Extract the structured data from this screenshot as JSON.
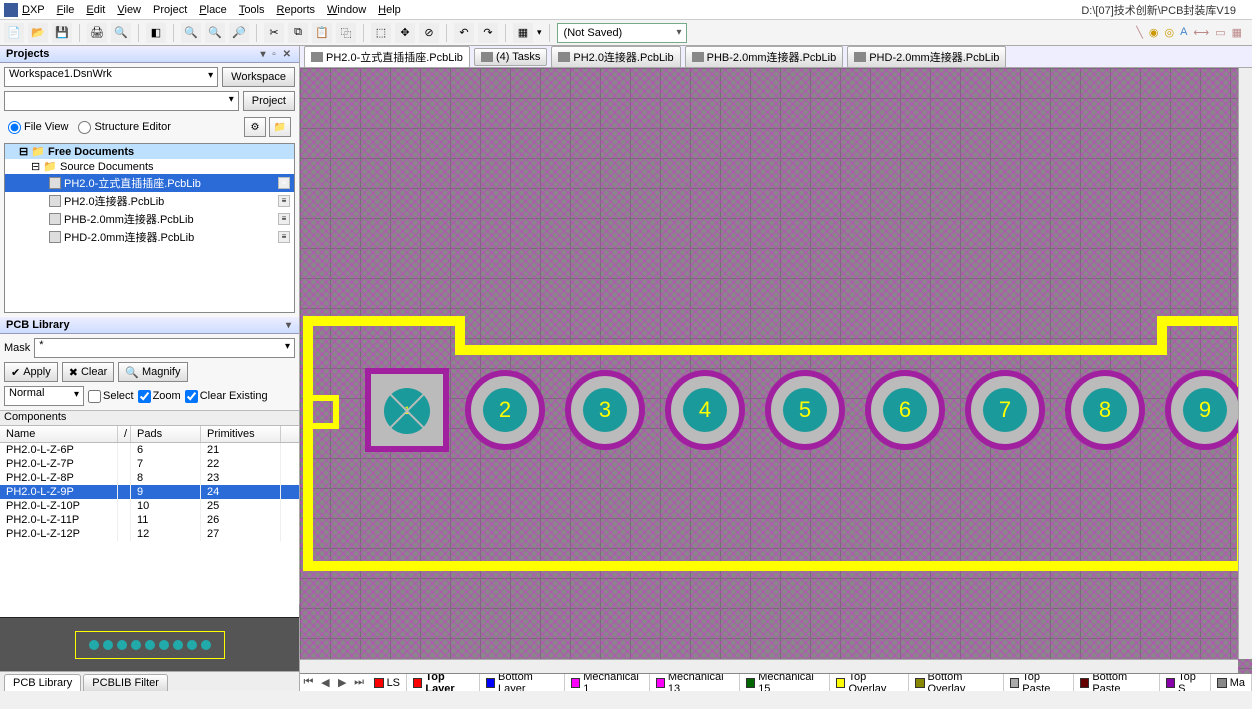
{
  "menu": {
    "dxp": "DXP",
    "file": "File",
    "edit": "Edit",
    "view": "View",
    "project": "Project",
    "place": "Place",
    "tools": "Tools",
    "reports": "Reports",
    "window": "Window",
    "help": "Help"
  },
  "title_path": "D:\\[07]技术创新\\PCB封装库V19",
  "toolbar": {
    "not_saved": "(Not Saved)"
  },
  "projects_panel": {
    "title": "Projects",
    "workspace": "Workspace1.DsnWrk",
    "workspace_btn": "Workspace",
    "project_btn": "Project",
    "file_view": "File View",
    "structure_editor": "Structure Editor"
  },
  "tree": {
    "root": "Free Documents",
    "src": "Source Documents",
    "files": [
      {
        "name": "PH2.0-立式直插插座.PcbLib",
        "selected": true
      },
      {
        "name": "PH2.0连接器.PcbLib"
      },
      {
        "name": "PHB-2.0mm连接器.PcbLib"
      },
      {
        "name": "PHD-2.0mm连接器.PcbLib"
      }
    ]
  },
  "pcblib_panel": {
    "title": "PCB Library",
    "mask": "Mask",
    "mask_val": "*",
    "apply": "Apply",
    "clear": "Clear",
    "magnify": "Magnify",
    "normal": "Normal",
    "select": "Select",
    "zoom": "Zoom",
    "clear_existing": "Clear Existing",
    "components": "Components",
    "hdr_name": "Name",
    "hdr_pads": "Pads",
    "hdr_prim": "Primitives"
  },
  "components": [
    {
      "name": "PH2.0-L-Z-6P",
      "pads": "6",
      "prim": "21"
    },
    {
      "name": "PH2.0-L-Z-7P",
      "pads": "7",
      "prim": "22"
    },
    {
      "name": "PH2.0-L-Z-8P",
      "pads": "8",
      "prim": "23"
    },
    {
      "name": "PH2.0-L-Z-9P",
      "pads": "9",
      "prim": "24",
      "selected": true
    },
    {
      "name": "PH2.0-L-Z-10P",
      "pads": "10",
      "prim": "25"
    },
    {
      "name": "PH2.0-L-Z-11P",
      "pads": "11",
      "prim": "26"
    },
    {
      "name": "PH2.0-L-Z-12P",
      "pads": "12",
      "prim": "27"
    }
  ],
  "bottom_tabs": {
    "pcb_library": "PCB Library",
    "pcblib_filter": "PCBLIB Filter"
  },
  "filetabs": [
    {
      "label": "PH2.0-立式直插插座.PcbLib",
      "active": true
    },
    {
      "label": "(4) Tasks"
    },
    {
      "label": "PH2.0连接器.PcbLib"
    },
    {
      "label": "PHB-2.0mm连接器.PcbLib"
    },
    {
      "label": "PHD-2.0mm连接器.PcbLib"
    }
  ],
  "pads": [
    "1",
    "2",
    "3",
    "4",
    "5",
    "6",
    "7",
    "8",
    "9"
  ],
  "layers": [
    {
      "label": "LS",
      "color": "#ff0000",
      "active": false
    },
    {
      "label": "Top Layer",
      "color": "#ff0000",
      "active": true
    },
    {
      "label": "Bottom Layer",
      "color": "#0000ff"
    },
    {
      "label": "Mechanical 1",
      "color": "#ff00ff"
    },
    {
      "label": "Mechanical 13",
      "color": "#ff00ff"
    },
    {
      "label": "Mechanical 15",
      "color": "#006600"
    },
    {
      "label": "Top Overlay",
      "color": "#ffff00"
    },
    {
      "label": "Bottom Overlay",
      "color": "#888800"
    },
    {
      "label": "Top Paste",
      "color": "#aaaaaa"
    },
    {
      "label": "Bottom Paste",
      "color": "#660000"
    },
    {
      "label": "Top S",
      "color": "#8800aa"
    },
    {
      "label": "Ma",
      "color": "#888888"
    }
  ]
}
